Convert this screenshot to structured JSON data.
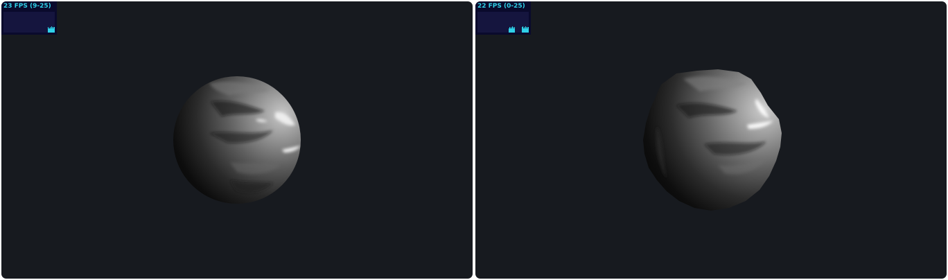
{
  "viewports": [
    {
      "fps_label": "23 FPS (9-25)",
      "fps_bars": [
        0,
        0,
        0,
        0,
        0,
        0,
        0,
        0,
        0,
        0,
        0,
        0,
        0,
        0,
        0,
        0,
        0,
        0,
        0,
        0,
        0,
        0,
        0,
        0,
        0,
        0,
        0,
        0,
        0,
        0,
        0,
        0,
        0,
        0,
        0,
        0,
        0,
        0,
        0,
        0,
        0,
        0,
        0,
        0,
        0,
        0,
        0,
        0,
        0,
        0,
        0,
        0,
        0,
        0,
        0,
        0,
        0,
        0,
        0,
        0,
        0,
        0,
        0,
        0,
        0.25,
        0.2,
        0.2,
        0.25,
        0.2,
        0.3,
        0.25,
        0.2,
        0.25,
        0.25
      ]
    },
    {
      "fps_label": "22 FPS (0-25)",
      "fps_bars": [
        0,
        0,
        0,
        0,
        0,
        0,
        0,
        0,
        0,
        0,
        0,
        0,
        0,
        0,
        0,
        0,
        0,
        0,
        0,
        0,
        0,
        0,
        0,
        0,
        0,
        0,
        0,
        0,
        0,
        0,
        0,
        0,
        0,
        0,
        0,
        0,
        0,
        0,
        0,
        0,
        0,
        0,
        0,
        0,
        0,
        0.2,
        0.25,
        0.2,
        0.25,
        0.2,
        0.3,
        0.25,
        0.2,
        0.25,
        0,
        0,
        0,
        0,
        0,
        0,
        0,
        0,
        0,
        0,
        0.25,
        0.3,
        0.2,
        0.25,
        0.2,
        0.3,
        0.25,
        0.2,
        0.25,
        0.25
      ]
    }
  ],
  "colors": {
    "viewport_bg": "#171a1f",
    "fps_text": "#2fd0e8",
    "fps_panel_bg": "#0a0a2c",
    "fps_graph_bg": "#15153e"
  }
}
